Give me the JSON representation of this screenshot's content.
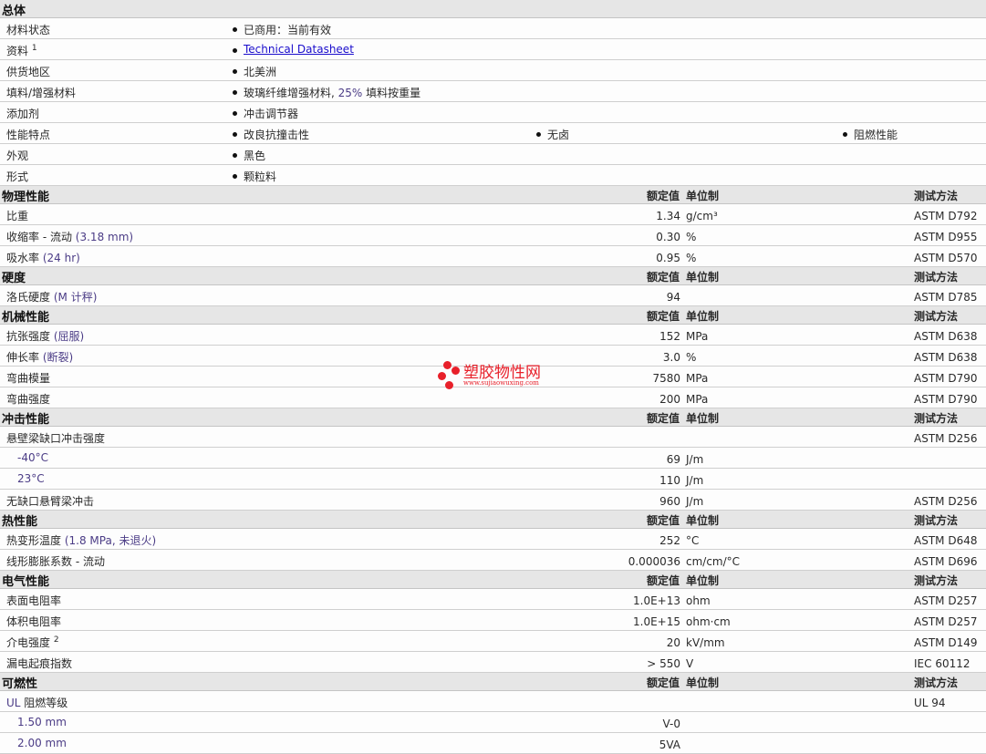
{
  "general": {
    "title": "总体",
    "rows": [
      {
        "label": "材料状态",
        "values": [
          "已商用：当前有效"
        ]
      },
      {
        "label": "资料",
        "sup": "1",
        "link": "Technical Datasheet"
      },
      {
        "label": "供货地区",
        "values": [
          "北美洲"
        ]
      },
      {
        "label": "填料/增强材料",
        "pre": "玻璃纤维增强材料, ",
        "acc": "25%",
        "post": " 填料按重量"
      },
      {
        "label": "添加剂",
        "values": [
          "冲击调节器"
        ]
      },
      {
        "label": "性能特点",
        "values": [
          "改良抗撞击性",
          "无卤",
          "阻燃性能"
        ]
      },
      {
        "label": "外观",
        "values": [
          "黑色"
        ]
      },
      {
        "label": "形式",
        "values": [
          "颗粒料"
        ]
      }
    ]
  },
  "headers": {
    "value": "额定值",
    "unit": "单位制",
    "method": "测试方法"
  },
  "sections": [
    {
      "title": "物理性能",
      "rows": [
        {
          "label": "比重",
          "value": "1.34",
          "unit": "g/cm³",
          "method": "ASTM D792"
        },
        {
          "label": "收缩率  - 流动",
          "note": "(3.18 mm)",
          "value": "0.30",
          "unit": "%",
          "method": "ASTM D955"
        },
        {
          "label": "吸水率",
          "note": "(24 hr)",
          "value": "0.95",
          "unit": "%",
          "method": "ASTM D570"
        }
      ]
    },
    {
      "title": "硬度",
      "rows": [
        {
          "label": "洛氏硬度",
          "note": "(M 计秤)",
          "value": "94",
          "unit": "",
          "method": "ASTM D785"
        }
      ]
    },
    {
      "title": "机械性能",
      "rows": [
        {
          "label": "抗张强度",
          "note": "(屈服)",
          "value": "152",
          "unit": "MPa",
          "method": "ASTM D638"
        },
        {
          "label": "伸长率",
          "note": "(断裂)",
          "value": "3.0",
          "unit": "%",
          "method": "ASTM D638"
        },
        {
          "label": "弯曲模量",
          "value": "7580",
          "unit": "MPa",
          "method": "ASTM D790"
        },
        {
          "label": "弯曲强度",
          "value": "200",
          "unit": "MPa",
          "method": "ASTM D790"
        }
      ]
    },
    {
      "title": "冲击性能",
      "rows": [
        {
          "label": "悬壁梁缺口冲击强度",
          "value": "",
          "unit": "",
          "method": "ASTM D256"
        },
        {
          "label": "-40°C",
          "indent": true,
          "value": "69",
          "unit": "J/m",
          "method": ""
        },
        {
          "label": "23°C",
          "indent": true,
          "value": "110",
          "unit": "J/m",
          "method": ""
        },
        {
          "label": "无缺口悬臂梁冲击",
          "value": "960",
          "unit": "J/m",
          "method": "ASTM D256"
        }
      ]
    },
    {
      "title": "热性能",
      "rows": [
        {
          "label": "热变形温度",
          "note": "(1.8 MPa, 未退火)",
          "value": "252",
          "unit": "°C",
          "method": "ASTM D648"
        },
        {
          "label": "线形膨胀系数  - 流动",
          "value": "0.000036",
          "unit": "cm/cm/°C",
          "method": "ASTM D696"
        }
      ]
    },
    {
      "title": "电气性能",
      "rows": [
        {
          "label": "表面电阻率",
          "value": "1.0E+13",
          "unit": "ohm",
          "method": "ASTM D257"
        },
        {
          "label": "体积电阻率",
          "value": "1.0E+15",
          "unit": "ohm·cm",
          "method": "ASTM D257"
        },
        {
          "label": "介电强度",
          "sup": "2",
          "value": "20",
          "unit": "kV/mm",
          "method": "ASTM D149"
        },
        {
          "label": "漏电起痕指数",
          "value": "> 550",
          "unit": "V",
          "method": "IEC 60112"
        }
      ]
    },
    {
      "title": "可燃性",
      "rows": [
        {
          "label": "UL 阻燃等级",
          "value": "",
          "unit": "",
          "method": "UL 94"
        },
        {
          "label": "1.50 mm",
          "indent": true,
          "value": "V-0",
          "unit": "",
          "method": ""
        },
        {
          "label": "2.00 mm",
          "indent": true,
          "value": "5VA",
          "unit": "",
          "method": ""
        }
      ]
    }
  ],
  "watermark": {
    "name": "塑胶物性网",
    "url": "www.sujiaowuxing.com"
  }
}
